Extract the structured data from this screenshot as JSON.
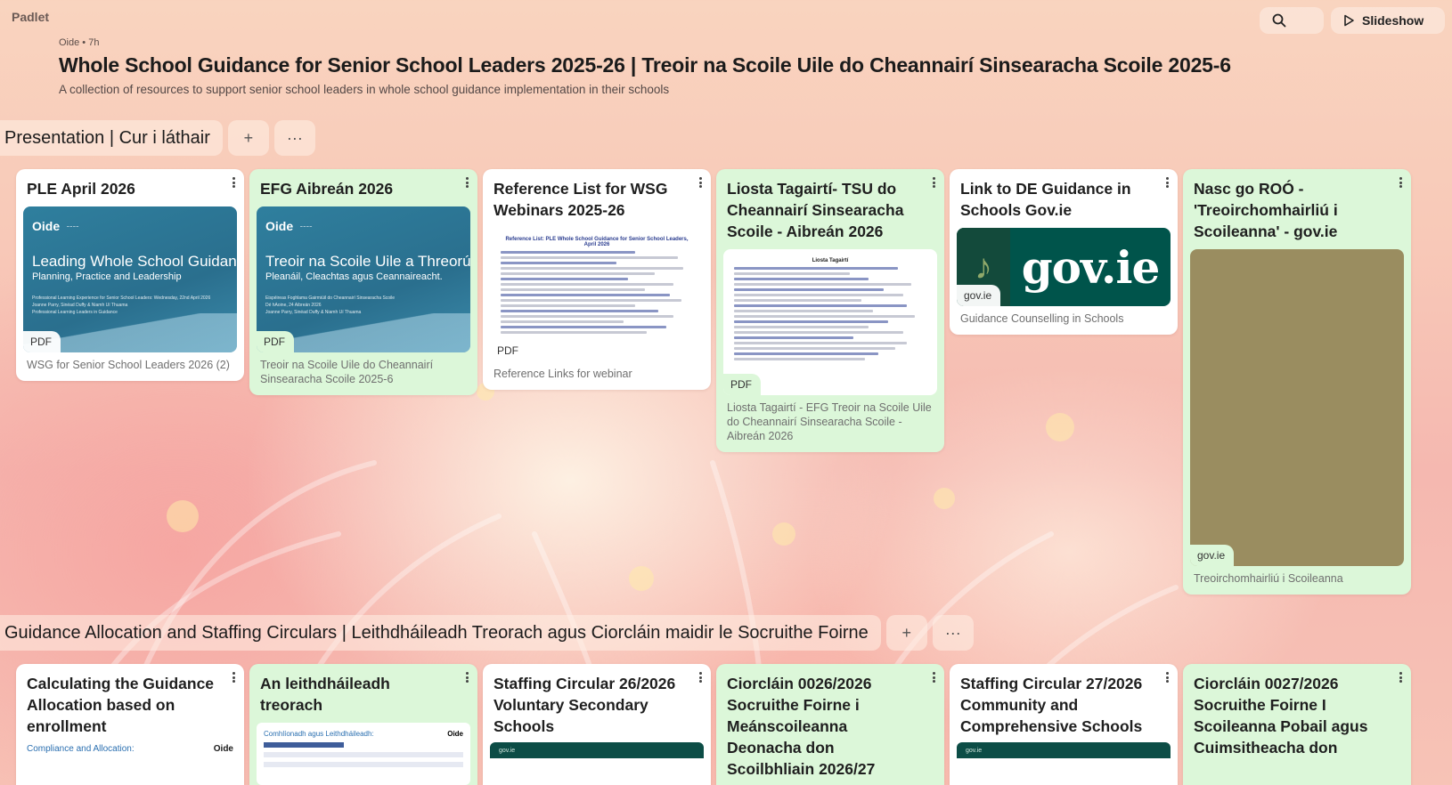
{
  "app": {
    "logo": "Padlet"
  },
  "toolbar": {
    "search_label": "",
    "slideshow_label": "Slideshow"
  },
  "header": {
    "author": "Oide",
    "time": "7h",
    "title": "Whole School Guidance for Senior School Leaders 2025-26 | Treoir na Scoile Uile do Cheannairí Sinsearacha Scoile 2025-6",
    "subtitle": "A collection of resources to support senior school leaders in whole school guidance implementation in their schools"
  },
  "sections": [
    {
      "title": "Presentation | Cur i láthair",
      "add_label": "+",
      "more_label": "···",
      "cards": [
        {
          "title": "PLE April 2026",
          "badge": "PDF",
          "caption": "WSG for Senior School Leaders 2026 (2)",
          "thumb": {
            "brand": "Oide",
            "big": "Leading Whole School Guidance",
            "sub": "Planning, Practice and Leadership",
            "tiny1": "Professional Learning Experience for Senior School Leaders: Wednesday, 22nd April 2026",
            "tiny2": "Joanne Parry, Sinéad Duffy & Niamh Uí Thuama",
            "tiny3": "Professional Learning Leaders in Guidance"
          }
        },
        {
          "title": "EFG Aibreán 2026",
          "badge": "PDF",
          "caption": "Treoir na Scoile Uile do Cheannairí Sinsearacha Scoile 2025-6",
          "thumb": {
            "brand": "Oide",
            "big": "Treoir na Scoile Uile a Threorú",
            "sub": "Pleanáil, Cleachtas agus Ceannaireacht.",
            "tiny1": "Eispéireas Foghlama Gairmiúil do Cheannairí Sinsearacha Scoile",
            "tiny2": "Dé hAoine, 24 Aibreán 2026",
            "tiny3": "Joanne Parry, Sinéad Duffy & Niamh Uí Thuama"
          }
        },
        {
          "title": "Reference List for WSG Webinars 2025-26",
          "badge": "PDF",
          "caption": "Reference Links for webinar",
          "thumb": {
            "heading": "Reference List: PLE Whole School Guidance for Senior School Leaders, April 2026"
          }
        },
        {
          "title": "Liosta Tagairtí- TSU do Cheannairí Sinsearacha Scoile - Aibreán 2026",
          "badge": "PDF",
          "caption": "Liosta Tagairtí - EFG Treoir na Scoile Uile do Cheannairí Sinsearacha Scoile - Aibreán 2026",
          "thumb": {
            "heading": "Liosta Tagairtí"
          }
        },
        {
          "title": "Link to DE Guidance in Schools Gov.ie",
          "badge": "gov.ie",
          "caption": "Guidance Counselling in Schools",
          "thumb": {
            "word": "gov.ie"
          }
        },
        {
          "title": "Nasc go ROÓ - 'Treoirchomhairliú i Scoileanna' - gov.ie",
          "badge": "gov.ie",
          "caption": "Treoirchomhairliú i Scoileanna"
        }
      ]
    },
    {
      "title": "Guidance Allocation and Staffing Circulars | Leithdháileadh Treorach agus Ciorcláin maidir le Socruithe Foirne",
      "add_label": "+",
      "more_label": "···",
      "cards": [
        {
          "title": "Calculating the Guidance Allocation based on enrollment",
          "thumb_text": "Compliance and Allocation:",
          "thumb_brand": "Oide"
        },
        {
          "title": "An leithdháileadh treorach",
          "thumb_text": "Comhlíonadh agus Leithdháileadh:",
          "thumb_brand": "Oide"
        },
        {
          "title": "Staffing Circular 26/2026 Voluntary Secondary Schools",
          "strip": "gov.ie"
        },
        {
          "title": "Ciorcláin 0026/2026 Socruithe Foirne i Meánscoileanna Deonacha don Scoilbhliain 2026/27"
        },
        {
          "title": "Staffing Circular 27/2026 Community and Comprehensive Schools",
          "strip": "gov.ie"
        },
        {
          "title": "Ciorcláin 0027/2026 Socruithe Foirne I Scoileanna Pobail agus Cuimsitheacha don"
        }
      ]
    }
  ],
  "colors": {
    "card_white": "#ffffff",
    "card_green": "#dcf7d9",
    "slide_blue": "#2f7f9e",
    "gov_green": "#00544b"
  },
  "icons": {
    "search": "search-icon",
    "slideshow": "play-icon",
    "more": "more-vertical-icon"
  }
}
